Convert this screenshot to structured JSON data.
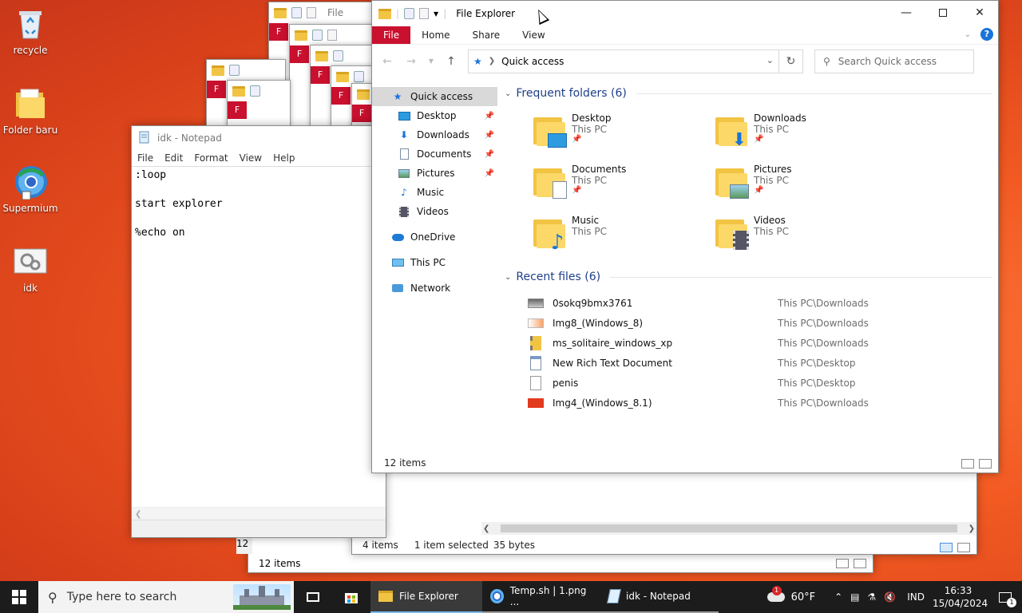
{
  "desktop": {
    "icons": [
      {
        "label": "recycle"
      },
      {
        "label": "Folder baru"
      },
      {
        "label": "Supermium"
      },
      {
        "label": "idk"
      }
    ]
  },
  "stack_windows": {
    "file_label": "F",
    "file_label_long": "File"
  },
  "notepad": {
    "title": "idk - Notepad",
    "menu": [
      "File",
      "Edit",
      "Format",
      "View",
      "Help"
    ],
    "content": ":loop\n\nstart explorer\n\n%echo on"
  },
  "explorer_back": {
    "status_items": "4 items",
    "status_selected": "1 item selected",
    "status_size": "35 bytes"
  },
  "explorer_third": {
    "status_items": "12 items",
    "partial_count": "12"
  },
  "explorer": {
    "title": "File Explorer",
    "ribbon": {
      "file": "File",
      "tabs": [
        "Home",
        "Share",
        "View"
      ],
      "help": "?"
    },
    "address": "Quick access",
    "search_placeholder": "Search Quick access",
    "nav": [
      {
        "label": "Quick access",
        "icon": "star-icon",
        "pinned": false
      },
      {
        "label": "Desktop",
        "icon": "desktop-icon",
        "pinned": true
      },
      {
        "label": "Downloads",
        "icon": "download-arrow-icon",
        "pinned": true
      },
      {
        "label": "Documents",
        "icon": "document-icon",
        "pinned": true
      },
      {
        "label": "Pictures",
        "icon": "picture-icon",
        "pinned": true
      },
      {
        "label": "Music",
        "icon": "music-note-icon",
        "pinned": false
      },
      {
        "label": "Videos",
        "icon": "film-icon",
        "pinned": false
      },
      {
        "label": "OneDrive",
        "icon": "cloud-icon",
        "pinned": false
      },
      {
        "label": "This PC",
        "icon": "computer-icon",
        "pinned": false
      },
      {
        "label": "Network",
        "icon": "network-icon",
        "pinned": false
      }
    ],
    "frequent_heading": "Frequent folders (6)",
    "frequent": [
      {
        "name": "Desktop",
        "location": "This PC",
        "pinned": true
      },
      {
        "name": "Downloads",
        "location": "This PC",
        "pinned": true
      },
      {
        "name": "Documents",
        "location": "This PC",
        "pinned": true
      },
      {
        "name": "Pictures",
        "location": "This PC",
        "pinned": true
      },
      {
        "name": "Music",
        "location": "This PC",
        "pinned": false
      },
      {
        "name": "Videos",
        "location": "This PC",
        "pinned": false
      }
    ],
    "recent_heading": "Recent files (6)",
    "recent": [
      {
        "name": "0sokq9bmx3761",
        "path": "This PC\\Downloads",
        "icon": "image-file-icon"
      },
      {
        "name": "Img8_(Windows_8)",
        "path": "This PC\\Downloads",
        "icon": "image-file-icon"
      },
      {
        "name": "ms_solitaire_windows_xp",
        "path": "This PC\\Downloads",
        "icon": "zip-folder-icon"
      },
      {
        "name": "New Rich Text Document",
        "path": "This PC\\Desktop",
        "icon": "rtf-document-icon"
      },
      {
        "name": "penis",
        "path": "This PC\\Desktop",
        "icon": "text-file-icon"
      },
      {
        "name": "Img4_(Windows_8.1)",
        "path": "This PC\\Downloads",
        "icon": "image-file-icon"
      }
    ],
    "status_items": "12 items"
  },
  "taskbar": {
    "search_placeholder": "Type here to search",
    "apps": [
      {
        "label": "File Explorer",
        "icon": "folder-icon",
        "active": true
      },
      {
        "label": "Temp.sh | 1.png ...",
        "icon": "browser-icon",
        "active": false
      },
      {
        "label": "idk - Notepad",
        "icon": "notepad-icon",
        "active": false
      }
    ],
    "weather_temp": "60°F",
    "weather_badge": "1",
    "language": "IND",
    "time": "16:33",
    "date": "15/04/2024",
    "notification_count": "1"
  },
  "colors": {
    "ribbon_file": "#c9102e",
    "accent": "#1a73d9",
    "taskbar": "#1c1c1c"
  }
}
